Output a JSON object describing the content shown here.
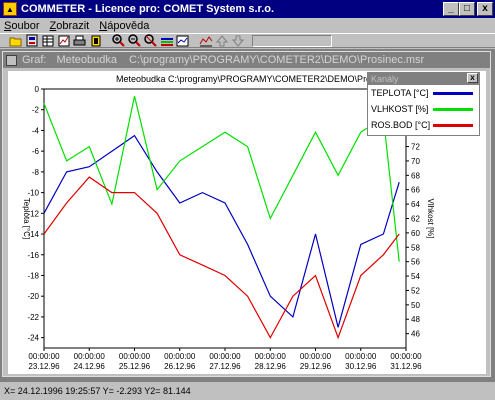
{
  "window": {
    "title": "COMMETER - Licence pro: COMET System s.r.o.",
    "minimize": "_",
    "maximize": "□",
    "close": "x"
  },
  "menu": [
    {
      "underline": "S",
      "rest": "oubor"
    },
    {
      "underline": "Z",
      "rest": "obrazit"
    },
    {
      "underline": "N",
      "rest": "ápověda"
    }
  ],
  "child": {
    "title": "Graf:",
    "device": "Meteobudka",
    "path": "C:\\programy\\PROGRAMY\\COMETER2\\DEMO\\Prosinec.msr"
  },
  "plot_header": "Meteobudka    C:\\programy\\PROGRAMY\\COMETER2\\DEMO\\Prosinec.msr",
  "legend": {
    "title": "Kanály",
    "close": "x",
    "items": [
      {
        "label": "TEPLOTA [°C]",
        "color": "#0000c0"
      },
      {
        "label": "VLHKOST [%]",
        "color": "#00e000"
      },
      {
        "label": "ROS.BOD [°C]",
        "color": "#e00000"
      }
    ]
  },
  "status": "X= 24.12.1996 19:25:57   Y= -2.293   Y2= 81.144",
  "chart_data": {
    "type": "line",
    "ylabel": "Teplota [°C]",
    "y2label": "Vlhkost [%]",
    "ylim": [
      -25,
      0
    ],
    "y2lim": [
      44,
      80
    ],
    "yticks": [
      "0",
      "-2",
      "-4",
      "-6",
      "-8",
      "-10",
      "-12",
      "-14",
      "-16",
      "-18",
      "-20",
      "-22",
      "-24"
    ],
    "y2ticks": [
      "80",
      "78",
      "76",
      "74",
      "72",
      "70",
      "68",
      "66",
      "64",
      "62",
      "60",
      "58",
      "56",
      "54",
      "52",
      "50",
      "48",
      "46"
    ],
    "xticks_time": [
      "00:00:00",
      "00:00:00",
      "00:00:00",
      "00:00:00",
      "00:00:00",
      "00:00:00",
      "00:00:00",
      "00:00:00",
      "00:00:00"
    ],
    "xticks_date": [
      "23.12.96",
      "24.12.96",
      "25.12.96",
      "26.12.96",
      "27.12.96",
      "28.12.96",
      "29.12.96",
      "30.12.96",
      "31.12.96"
    ],
    "x": [
      23.0,
      23.5,
      24.0,
      24.5,
      25.0,
      25.5,
      26.0,
      26.5,
      27.0,
      27.5,
      28.0,
      28.5,
      29.0,
      29.5,
      30.0,
      30.5,
      30.85
    ],
    "series": [
      {
        "name": "TEPLOTA [°C]",
        "axis": "left",
        "values": [
          -12,
          -8,
          -7.5,
          -6,
          -4.5,
          -8,
          -11,
          -10,
          -11,
          -15,
          -20,
          -22,
          -14,
          -23,
          -15,
          -14,
          -9
        ]
      },
      {
        "name": "VLHKOST [%]",
        "axis": "right",
        "values": [
          78,
          70,
          72,
          64,
          79,
          66,
          70,
          72,
          74,
          72,
          62,
          68,
          74,
          68,
          74,
          76,
          56
        ]
      },
      {
        "name": "ROS.BOD [°C]",
        "axis": "left",
        "values": [
          -14,
          -11,
          -8.5,
          -10,
          -10,
          -12,
          -16,
          -17,
          -18,
          -20,
          -24,
          -20,
          -18,
          -24,
          -18,
          -16,
          -14
        ]
      }
    ]
  }
}
